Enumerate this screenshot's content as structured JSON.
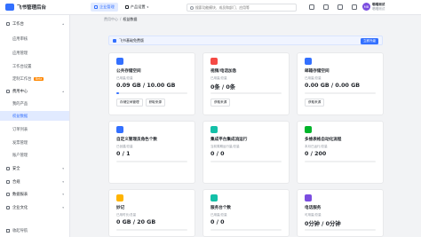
{
  "app": {
    "title": "飞书管理后台"
  },
  "topbar": {
    "nav": [
      {
        "label": "企业管理",
        "active": true
      },
      {
        "label": "产品设置",
        "active": false
      }
    ],
    "search_placeholder": "搜索功能模块、成员和部门、应用等",
    "user": {
      "name": "唱唱测试",
      "org": "唱唱测试",
      "avatar": "MB"
    }
  },
  "sidebar": {
    "items": [
      {
        "label": "工作台",
        "type": "group"
      },
      {
        "label": "应用审核",
        "type": "sub"
      },
      {
        "label": "应用管理",
        "type": "sub"
      },
      {
        "label": "工作台设置",
        "type": "sub"
      },
      {
        "label": "定制工作台",
        "type": "sub",
        "badge": "Beta"
      },
      {
        "label": "费用中心",
        "type": "group"
      },
      {
        "label": "我的产品",
        "type": "sub"
      },
      {
        "label": "权益数据",
        "type": "sub",
        "active": true
      },
      {
        "label": "订单列表",
        "type": "sub"
      },
      {
        "label": "发票管理",
        "type": "sub"
      },
      {
        "label": "账户管理",
        "type": "sub"
      },
      {
        "label": "安全",
        "type": "group"
      },
      {
        "label": "合规",
        "type": "group"
      },
      {
        "label": "数据报表",
        "type": "group"
      },
      {
        "label": "企业文化",
        "type": "group"
      }
    ],
    "collapse_label": "收起导航"
  },
  "breadcrumb": [
    "费用中心",
    "权益数据"
  ],
  "banner": {
    "text": "飞书基础免费版",
    "button": "立即升级"
  },
  "cards": [
    {
      "title": "公共存储空间",
      "meta": "已用量/总量",
      "value": "0.09 GB / 10.00 GB",
      "progress": 0.01,
      "buttons": [
        "存储空间管理",
        "获取来源"
      ],
      "color": "#3370ff"
    },
    {
      "title": "视频/电话加急",
      "meta": "已用量/总量",
      "value": "0条 / 0条",
      "progress": 0,
      "buttons": [
        "获取来源"
      ],
      "color": "#f54a45"
    },
    {
      "title": "邮箱存储空间",
      "meta": "已用量/总量",
      "value": "0.00 GB / 0.00 GB",
      "progress": 0,
      "buttons": [
        "获取来源"
      ],
      "color": "#3370ff"
    },
    {
      "title": "自定义管理员角色个数",
      "meta": "已创建/总量",
      "value": "0 / 1",
      "progress": 0,
      "buttons": [],
      "color": "#3370ff"
    },
    {
      "title": "集成平台集成流运行",
      "meta": "当前周期运行量/总量",
      "value": "0 / 0",
      "progress": 0,
      "buttons": [],
      "color": "#14c0a8"
    },
    {
      "title": "多维表格自动化流程",
      "meta": "本月已运行/总量",
      "value": "0 / 200",
      "progress": 0,
      "buttons": [],
      "color": "#00b42a"
    },
    {
      "title": "妙记",
      "meta": "已用时长/总量",
      "value": "0 GB / 20 GB",
      "progress": 0,
      "buttons": [],
      "color": "#ffb400"
    },
    {
      "title": "服务台个数",
      "meta": "已用量/总量",
      "value": "0 / 0",
      "progress": 0,
      "buttons": [],
      "color": "#14c0a8"
    },
    {
      "title": "电话服务",
      "meta": "可用量/总量",
      "value": "0分钟 / 0分钟",
      "progress": 0,
      "buttons": [],
      "color": "#7b4de0"
    }
  ]
}
